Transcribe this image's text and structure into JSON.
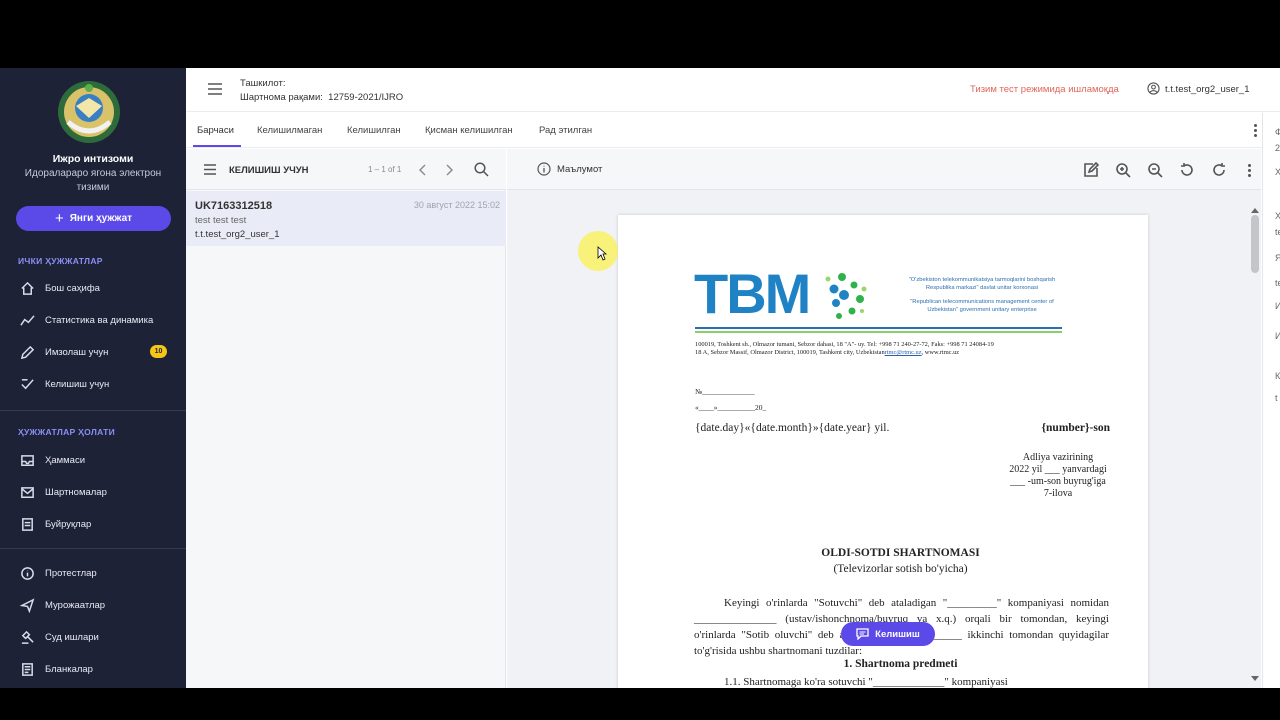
{
  "sidebar": {
    "org_name": "Ижро интизоми",
    "org_subtitle": "Идораларaро ягона электрон тизими",
    "new_doc_button": "Янги ҳужжат",
    "section_internal": "ИЧКИ ҲУЖЖАТЛАР",
    "internal_items": [
      {
        "label": "Бош саҳифа",
        "icon": "home-icon"
      },
      {
        "label": "Статистика ва динамика",
        "icon": "chart-icon"
      },
      {
        "label": "Имзолаш учун",
        "icon": "pen-icon",
        "badge": "10"
      },
      {
        "label": "Келишиш учун",
        "icon": "check-icon"
      }
    ],
    "section_status": "ҲУЖЖАТЛАР ҲОЛАТИ",
    "status_items": [
      {
        "label": "Ҳаммаси",
        "icon": "inbox-icon"
      },
      {
        "label": "Шартномалар",
        "icon": "mail-icon"
      },
      {
        "label": "Буйруқлар",
        "icon": "document-icon"
      }
    ],
    "other_items": [
      {
        "label": "Протестлар",
        "icon": "info-icon"
      },
      {
        "label": "Мурожаатлар",
        "icon": "send-icon"
      },
      {
        "label": "Суд ишлари",
        "icon": "gavel-icon"
      },
      {
        "label": "Бланкалар",
        "icon": "form-icon"
      }
    ]
  },
  "header": {
    "org_label": "Ташкилот:",
    "contract_label": "Шартнома рақами:",
    "contract_number": "12759-2021/IJRO",
    "test_mode": "Тизим тест режимида ишламоқда",
    "user": "t.t.test_org2_user_1"
  },
  "tabs": [
    "Барчаси",
    "Келишилмаган",
    "Келишилган",
    "Қисман келишилган",
    "Рад этилган"
  ],
  "list": {
    "title": "КЕЛИШИШ УЧУН",
    "count": "1 – 1 of 1",
    "items": [
      {
        "id": "UK7163312518",
        "date": "30 август 2022 15:02",
        "desc": "test test test",
        "user": "t.t.test_org2_user_1"
      }
    ]
  },
  "doc_toolbar": {
    "info_label": "Маълумот"
  },
  "doc": {
    "brand": "TBM",
    "org_uz": "\"O'zbekiston telekommunikatsiya tarmoqlarini boshqarish Respublika markazi\" davlat unitar korxonasi",
    "org_en": "\"Republican telecommunications management center of Uzbekistan\" government unitary enterprise",
    "address_1": "100019, Toshkent sh., Olmazor tumani, Sebzor dahasi, 18 \"A\"- uy. Tel: +998 71 240-27-72, Faks: +998 71 24084-19",
    "address_2": "18 A, Sebzor Massif, Olmazor District, 100019, Tashkent city, Uzbekistan",
    "address_email": "rtmc@rtmc.uz",
    "address_site": ", www.rtmc.uz",
    "ref_no": "№______________",
    "ref_date": "«____»__________20_",
    "date_line": "{date.day}«{date.month}»{date.year} yil.",
    "number_line": "{number}-son",
    "appendix": [
      "Adliya vazirining",
      "2022 yil ___ yanvardagi",
      "___ -um-son buyrug'iga",
      "7-ilova"
    ],
    "title": "OLDI-SOTDI SHARTNOMASI",
    "subtitle": "(Televizorlar sotish bo'yicha)",
    "para1": "Keyingi o'rinlarda \"Sotuvchi\" deb ataladigan \"_________\" kompaniyasi nomidan _______________ (ustav/ishonchnoma/buyruq va x.q.) orqali bir tomondan, keyingi o'rinlarda \"Sotib oluvchi\" deb ataladigan _____________ ikkinchi tomondan quyidagilar to'g'risida ushbu shartnomani tuzdilar:",
    "section1": "1. Shartnoma predmeti",
    "para2": "1.1. Shartnomaga ko'ra sotuvchi \"_____________\" kompaniyasi"
  },
  "agree_button": "Келишиш",
  "right_panel": [
    "Ф",
    "2",
    "Х",
    "Х",
    "te",
    "Я",
    "te",
    "И",
    "И",
    "К",
    "t"
  ]
}
